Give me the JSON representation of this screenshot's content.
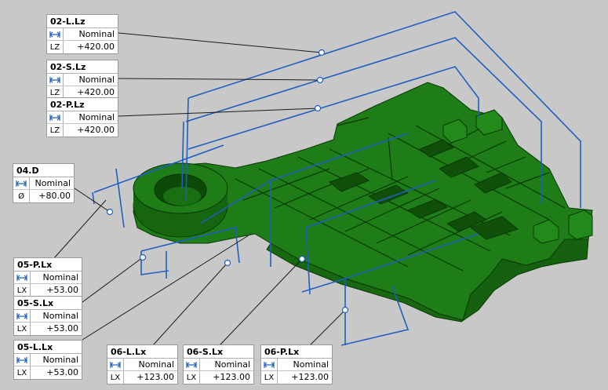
{
  "colors": {
    "background": "#c8c8c8",
    "part": "#1e7d16",
    "part_dark": "#0d4a08",
    "leader": "#1f5fbf",
    "callout_bg": "#ffffff"
  },
  "icons": {
    "measure": "horizontal-double-arrow-icon"
  },
  "annotations": [
    {
      "id": "02-L.Lz",
      "title": "02-L.Lz",
      "type": "Nominal",
      "axis": "LZ",
      "value": "+420.00"
    },
    {
      "id": "02-S.Lz",
      "title": "02-S.Lz",
      "type": "Nominal",
      "axis": "LZ",
      "value": "+420.00"
    },
    {
      "id": "02-P.Lz",
      "title": "02-P.Lz",
      "type": "Nominal",
      "axis": "LZ",
      "value": "+420.00"
    },
    {
      "id": "04.D",
      "title": "04.D",
      "type": "Nominal",
      "axis": "Ø",
      "value": "+80.00"
    },
    {
      "id": "05-P.Lx",
      "title": "05-P.Lx",
      "type": "Nominal",
      "axis": "LX",
      "value": "+53.00"
    },
    {
      "id": "05-S.Lx",
      "title": "05-S.Lx",
      "type": "Nominal",
      "axis": "LX",
      "value": "+53.00"
    },
    {
      "id": "05-L.Lx",
      "title": "05-L.Lx",
      "type": "Nominal",
      "axis": "LX",
      "value": "+53.00"
    },
    {
      "id": "06-L.Lx",
      "title": "06-L.Lx",
      "type": "Nominal",
      "axis": "LX",
      "value": "+123.00"
    },
    {
      "id": "06-S.Lx",
      "title": "06-S.Lx",
      "type": "Nominal",
      "axis": "LX",
      "value": "+123.00"
    },
    {
      "id": "06-P.Lx",
      "title": "06-P.Lx",
      "type": "Nominal",
      "axis": "LX",
      "value": "+123.00"
    }
  ]
}
